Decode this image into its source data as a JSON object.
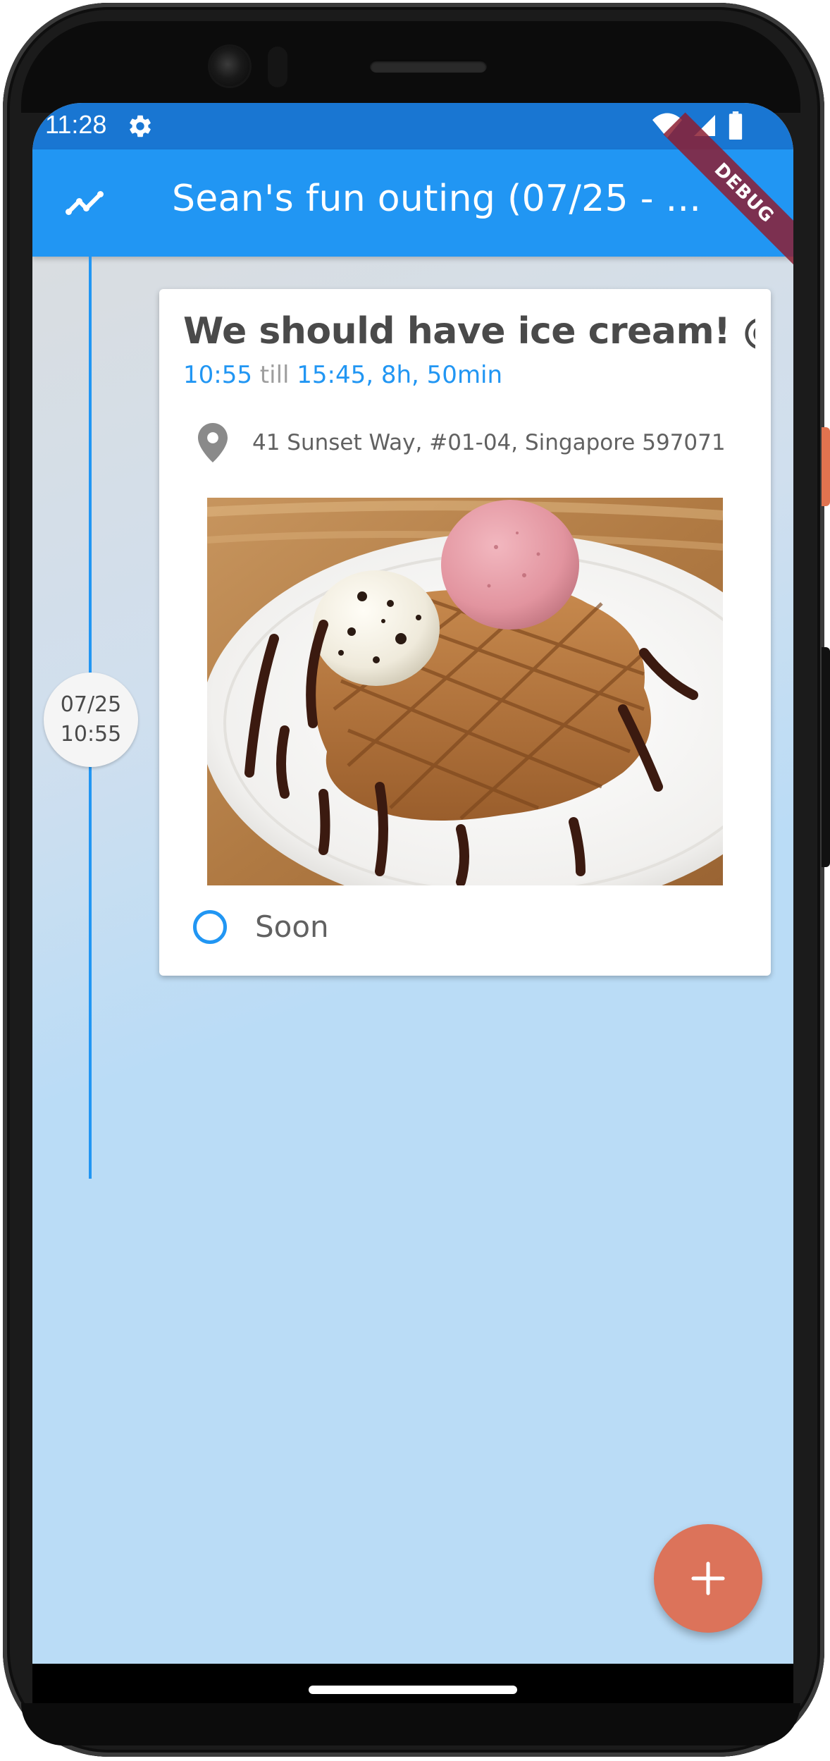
{
  "status_bar": {
    "time": "11:28"
  },
  "app_bar": {
    "title": "Sean's fun outing (07/25 - ...",
    "debug_label": "DEBUG"
  },
  "timeline": {
    "node_date": "07/25",
    "node_time": "10:55"
  },
  "event": {
    "title": "We should have ice cream!  @...",
    "start": "10:55",
    "till_label": "till",
    "end_duration": "15:45, 8h, 50min",
    "location": "41 Sunset Way, #01-04, Singapore 597071",
    "status": "Soon"
  },
  "colors": {
    "primary": "#2196f3",
    "status_bar": "#1976d2",
    "fab": "#dc735a",
    "text_dark": "#4a4a4a"
  },
  "icons": [
    "settings-gear-icon",
    "wifi-icon",
    "signal-icon",
    "battery-icon",
    "timeline-chart-icon",
    "location-pin-icon",
    "add-icon"
  ]
}
